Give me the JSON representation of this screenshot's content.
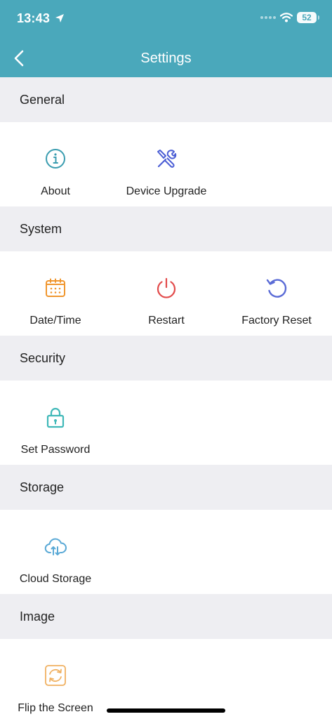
{
  "status": {
    "time": "13:43",
    "battery": "52"
  },
  "nav": {
    "title": "Settings"
  },
  "sections": {
    "general": {
      "title": "General",
      "items": [
        "About",
        "Device Upgrade"
      ]
    },
    "system": {
      "title": "System",
      "items": [
        "Date/Time",
        "Restart",
        "Factory Reset"
      ]
    },
    "security": {
      "title": "Security",
      "items": [
        "Set Password"
      ]
    },
    "storage": {
      "title": "Storage",
      "items": [
        "Cloud Storage"
      ]
    },
    "image": {
      "title": "Image",
      "items": [
        "Flip the Screen"
      ]
    }
  },
  "icons": {
    "about": "info-icon",
    "device_upgrade": "tools-icon",
    "date_time": "calendar-icon",
    "restart": "power-icon",
    "factory_reset": "refresh-icon",
    "set_password": "lock-icon",
    "cloud_storage": "cloud-icon",
    "flip_screen": "flip-icon"
  },
  "colors": {
    "accent": "#4aa8bb",
    "section_bg": "#eeeef2",
    "about": "#3b9db0",
    "upgrade": "#4c5fd5",
    "date": "#f0962e",
    "restart": "#e24a4a",
    "reset": "#5a6bd6",
    "lock": "#3fb8b8",
    "cloud": "#5aa9d6",
    "flip": "#f0b060"
  }
}
